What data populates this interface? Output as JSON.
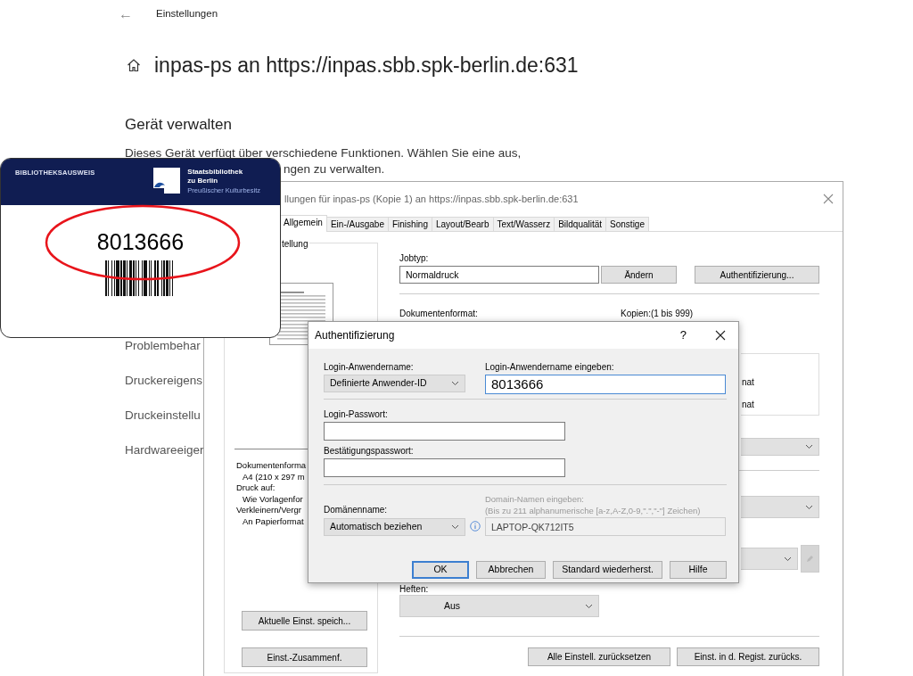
{
  "settings_page": {
    "back_arrow": "←",
    "header": "Einstellungen",
    "title": "inpas-ps an https://inpas.sbb.spk-berlin.de:631",
    "section_title": "Gerät verwalten",
    "description": [
      "Dieses Gerät verfügt über verschiedene Funktionen. Wählen Sie eine aus,",
      "ngen zu verwalten."
    ],
    "menu_items": [
      "Problembehar",
      "Druckereigens",
      "Druckeinstellu",
      "Hardwareeiger"
    ]
  },
  "printer_dialog": {
    "title": "llungen für inpas-ps (Kopie 1) an https://inpas.sbb.spk-berlin.de:631",
    "tabs": [
      {
        "label": "Allgemein",
        "selected": true
      },
      {
        "label": "Ein-/Ausgabe",
        "selected": false
      },
      {
        "label": "Finishing",
        "selected": false
      },
      {
        "label": "Layout/Bearb",
        "selected": false
      },
      {
        "label": "Text/Wasserz",
        "selected": false
      },
      {
        "label": "Bildqualität",
        "selected": false
      },
      {
        "label": "Sonstige",
        "selected": false
      }
    ],
    "preview_group_label": "tellung",
    "summary": [
      {
        "text": "Dokumentenforma",
        "kind": "heading"
      },
      {
        "text": "A4 (210 x 297 m",
        "kind": "value"
      },
      {
        "text": "Druck auf:",
        "kind": "heading"
      },
      {
        "text": "Wie Vorlagenfor",
        "kind": "value"
      },
      {
        "text": "Verkleinern/Vergr",
        "kind": "heading"
      },
      {
        "text": "An Papierformat",
        "kind": "value"
      }
    ],
    "left_buttons": [
      "Aktuelle Einst. speich...",
      "Einst.-Zusammenf."
    ],
    "job_type": {
      "label": "Jobtyp:",
      "value": "Normaldruck"
    },
    "change_button": "Ändern",
    "auth_button": "Authentifizierung...",
    "document_format_label": "Dokumentenformat:",
    "copies_label": "Kopien:(1 bis 999)",
    "format_options": [
      "nat",
      "nat"
    ],
    "stapling": {
      "label": "Heften:",
      "value": "Aus"
    },
    "bottom_buttons": [
      "Alle Einstell. zurücksetzen",
      "Einst. in d. Regist. zurücks."
    ]
  },
  "auth_dialog": {
    "title": "Authentifizierung",
    "help": "?",
    "user_mode": {
      "label": "Login-Anwendername:",
      "value": "Definierte Anwender-ID"
    },
    "user_name": {
      "label": "Login-Anwendername eingeben:",
      "value": "8013666"
    },
    "password": {
      "label": "Login-Passwort:"
    },
    "confirm_password": {
      "label": "Bestätigungspasswort:"
    },
    "domain_mode": {
      "label": "Domänenname:",
      "value": "Automatisch beziehen"
    },
    "domain_name": {
      "label": "Domain-Namen eingeben:",
      "hint": "(Bis zu 211 alphanumerische [a-z,A-Z,0-9,\".\",\"-\"] Zeichen)",
      "value": "LAPTOP-QK712IT5",
      "disabled": true
    },
    "buttons": [
      {
        "label": "OK",
        "default": true
      },
      {
        "label": "Abbrechen",
        "default": false
      },
      {
        "label": "Standard wiederherst.",
        "default": false
      },
      {
        "label": "Hilfe",
        "default": false
      }
    ]
  },
  "library_card": {
    "heading": "BIBLIOTHEKSAUSWEIS",
    "institution": [
      "Staatsbibliothek",
      "zu Berlin"
    ],
    "subtitle": "Preußischer Kulturbesitz",
    "number": "8013666",
    "number_highlighted": true
  }
}
